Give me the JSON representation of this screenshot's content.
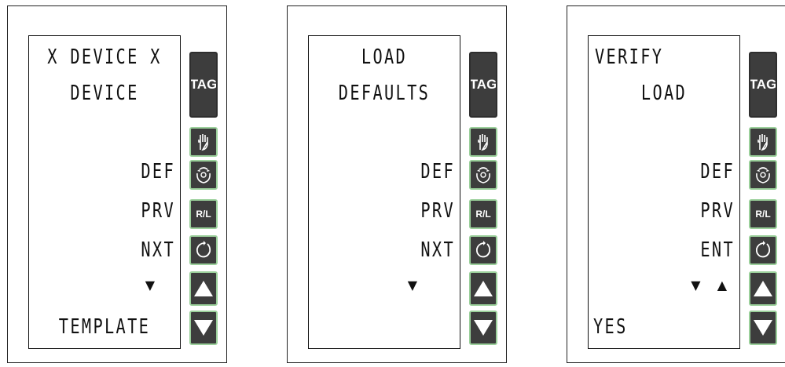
{
  "panels": [
    {
      "display": {
        "line1": "X DEVICE X",
        "line2": "DEVICE",
        "soft_def": "DEF",
        "soft_2": "PRV",
        "soft_3": "NXT",
        "arrows": "▼",
        "bottom": "TEMPLATE"
      }
    },
    {
      "display": {
        "line1": "LOAD",
        "line2": "DEFAULTS",
        "soft_def": "DEF",
        "soft_2": "PRV",
        "soft_3": "NXT",
        "arrows": "▼",
        "bottom": ""
      }
    },
    {
      "display": {
        "line1": "VERIFY",
        "line2": "LOAD",
        "soft_def": "DEF",
        "soft_2": "PRV",
        "soft_3": "ENT",
        "arrows": "▼ ▲",
        "bottom": "YES"
      }
    }
  ],
  "keypad": {
    "tag": "TAG",
    "hand_icon": "hand-icon",
    "torque_icon": "torque-icon",
    "rl": "R/L",
    "rotate_icon": "rotate-icon",
    "up_icon": "arrow-up-icon",
    "down_icon": "arrow-down-icon"
  },
  "colors": {
    "key_fill": "#3d3d3d",
    "key_border": "#9bd09b"
  }
}
